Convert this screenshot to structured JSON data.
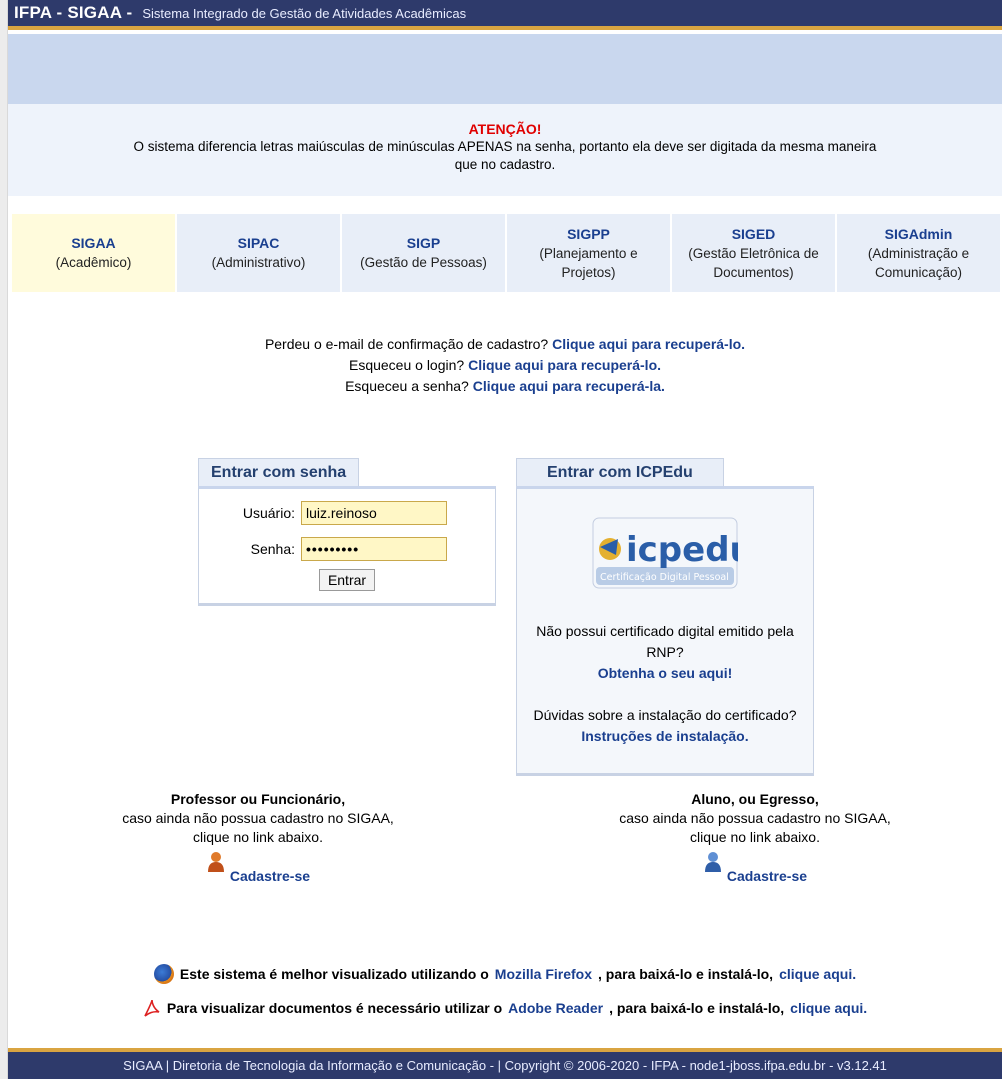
{
  "header": {
    "brand": "IFPA - SIGAA -",
    "subtitle": "Sistema Integrado de Gestão de Atividades Acadêmicas"
  },
  "attention": {
    "title": "ATENÇÃO!",
    "line1": "O sistema diferencia letras maiúsculas de minúsculas APENAS na senha, portanto ela deve ser digitada da mesma maneira",
    "line2": "que no cadastro."
  },
  "systems": [
    {
      "name": "SIGAA",
      "desc": "(Acadêmico)"
    },
    {
      "name": "SIPAC",
      "desc": "(Administrativo)"
    },
    {
      "name": "SIGP",
      "desc": "(Gestão de Pessoas)"
    },
    {
      "name": "SIGPP",
      "desc": "(Planejamento e Projetos)"
    },
    {
      "name": "SIGED",
      "desc": "(Gestão Eletrônica de Documentos)"
    },
    {
      "name": "SIGAdmin",
      "desc": "(Administração e Comunicação)"
    }
  ],
  "recovery": {
    "email_text": "Perdeu o e-mail de confirmação de cadastro?",
    "email_link": "Clique aqui para recuperá-lo.",
    "login_text": "Esqueceu o login?",
    "login_link": "Clique aqui para recuperá-lo.",
    "password_text": "Esqueceu a senha?",
    "password_link": "Clique aqui para recuperá-la."
  },
  "login": {
    "tab": "Entrar com senha",
    "user_label": "Usuário:",
    "user_value": "luiz.reinoso",
    "password_label": "Senha:",
    "password_value": "•••••••••",
    "submit": "Entrar"
  },
  "icp": {
    "tab": "Entrar com ICPEdu",
    "logo_text": "icpedu",
    "logo_sub": "Certificação Digital Pessoal",
    "no_cert": "Não possui certificado digital emitido pela RNP?",
    "get_link": "Obtenha o seu aqui!",
    "doubt": "Dúvidas sobre a instalação do certificado?",
    "install_link": "Instruções de instalação."
  },
  "register": {
    "staff": {
      "title": "Professor ou Funcionário,",
      "line1": "caso ainda não possua cadastro no SIGAA,",
      "line2": "clique no link abaixo.",
      "link": "Cadastre-se",
      "icon": "person-orange-icon"
    },
    "student": {
      "title": "Aluno, ou Egresso,",
      "line1": "caso ainda não possua cadastro no SIGAA,",
      "line2": "clique no link abaixo.",
      "link": "Cadastre-se",
      "icon": "person-blue-icon"
    }
  },
  "promos": {
    "firefox": {
      "icon": "firefox-icon",
      "text1": "Este sistema é melhor visualizado utilizando o",
      "link1": "Mozilla Firefox",
      "text2": ", para baixá-lo e instalá-lo,",
      "link2": "clique aqui."
    },
    "adobe": {
      "icon": "adobe-pdf-icon",
      "text1": "Para visualizar documentos é necessário utilizar o",
      "link1": "Adobe Reader",
      "text2": ", para baixá-lo e instalá-lo,",
      "link2": "clique aqui."
    }
  },
  "footer": {
    "text": "SIGAA | Diretoria de Tecnologia da Informação e Comunicação - | Copyright © 2006-2020 - IFPA - node1-jboss.ifpa.edu.br - v3.12.41"
  },
  "colors": {
    "header_bg": "#2e3a6b",
    "accent_gold": "#d9a441",
    "link": "#1a3f8f",
    "alert_red": "#e00000",
    "input_bg": "#fff7c6"
  }
}
